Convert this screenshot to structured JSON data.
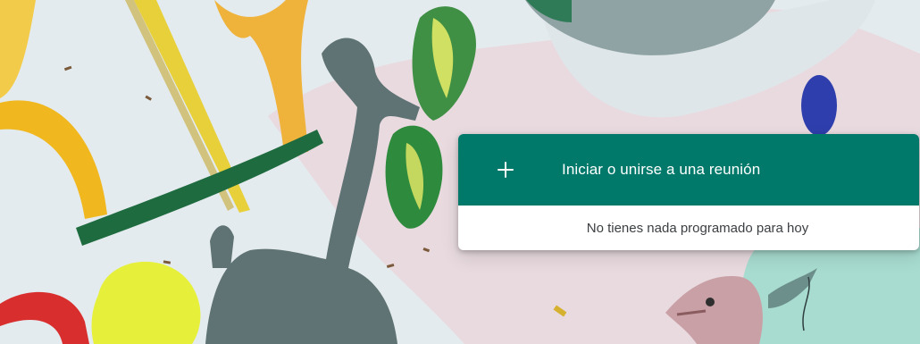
{
  "background": {
    "description_icon": "abstract-illustration"
  },
  "meeting_card": {
    "join_button": {
      "icon": "plus-icon",
      "label": "Iniciar o unirse a una reunión"
    },
    "schedule_message": "No tienes nada programado para hoy"
  },
  "colors": {
    "accent": "#00796b",
    "card_bg": "#ffffff",
    "message_text": "#3c4043"
  }
}
